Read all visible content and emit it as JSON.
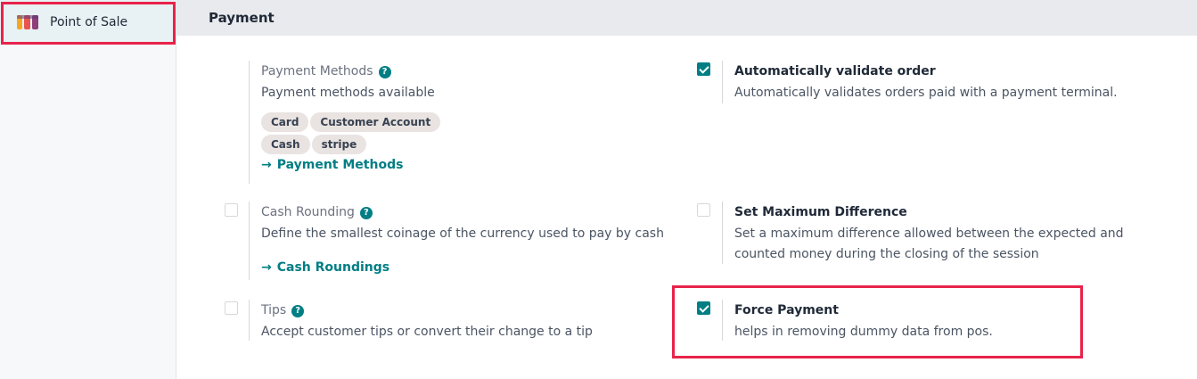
{
  "sidebar": {
    "items": [
      {
        "label": "Point of Sale",
        "icon": "point-of-sale-icon",
        "active": true
      }
    ]
  },
  "section": {
    "title": "Payment"
  },
  "settings": {
    "payment_methods": {
      "title": "Payment Methods",
      "description": "Payment methods available",
      "tags": [
        "Card",
        "Customer Account",
        "Cash",
        "stripe"
      ],
      "link_label": "Payment Methods"
    },
    "auto_validate": {
      "title": "Automatically validate order",
      "description": "Automatically validates orders paid with a payment terminal.",
      "checked": true
    },
    "cash_rounding": {
      "title": "Cash Rounding",
      "description": "Define the smallest coinage of the currency used to pay by cash",
      "link_label": "Cash Roundings",
      "checked": false
    },
    "max_difference": {
      "title": "Set Maximum Difference",
      "description": "Set a maximum difference allowed between the expected and counted money during the closing of the session",
      "checked": false
    },
    "tips": {
      "title": "Tips",
      "description": "Accept customer tips or convert their change to a tip",
      "checked": false
    },
    "force_payment": {
      "title": "Force Payment",
      "description": "helps in removing dummy data from pos.",
      "checked": true
    }
  },
  "colors": {
    "accent": "#017e84",
    "highlight": "#e8234a",
    "tag_bg": "#e9e3e1"
  }
}
